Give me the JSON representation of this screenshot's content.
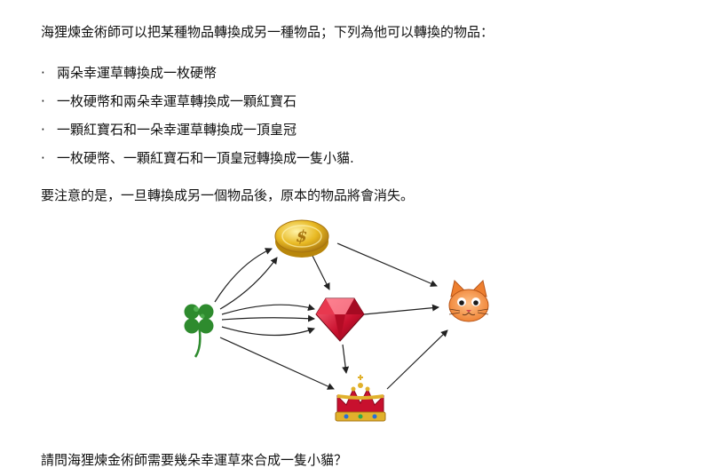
{
  "intro": "海狸煉金術師可以把某種物品轉換成另一種物品；下列為他可以轉換的物品：",
  "rules": [
    {
      "bullet": "·",
      "text": "兩朵幸運草轉換成一枚硬幣"
    },
    {
      "bullet": "·",
      "text": "一枚硬幣和兩朵幸運草轉換成一顆紅寶石"
    },
    {
      "bullet": "·",
      "text": "一顆紅寶石和一朵幸運草轉換成一頂皇冠"
    },
    {
      "bullet": "·",
      "text": "一枚硬幣、一顆紅寶石和一頂皇冠轉換成一隻小貓."
    }
  ],
  "note": "要注意的是，一旦轉換成另一個物品後，原本的物品將會消失。",
  "question": "請問海狸煉金術師需要幾朵幸運草來合成一隻小貓？",
  "diagram": {
    "items": [
      "clover-icon",
      "coin-icon",
      "ruby-icon",
      "crown-icon",
      "cat-icon"
    ],
    "colors": {
      "clover": "#2e8b2e",
      "coin": "#e0b020",
      "ruby": "#c8102e",
      "crown": "#d4a017",
      "cat": "#f08a3c",
      "arrow": "#222222"
    }
  }
}
